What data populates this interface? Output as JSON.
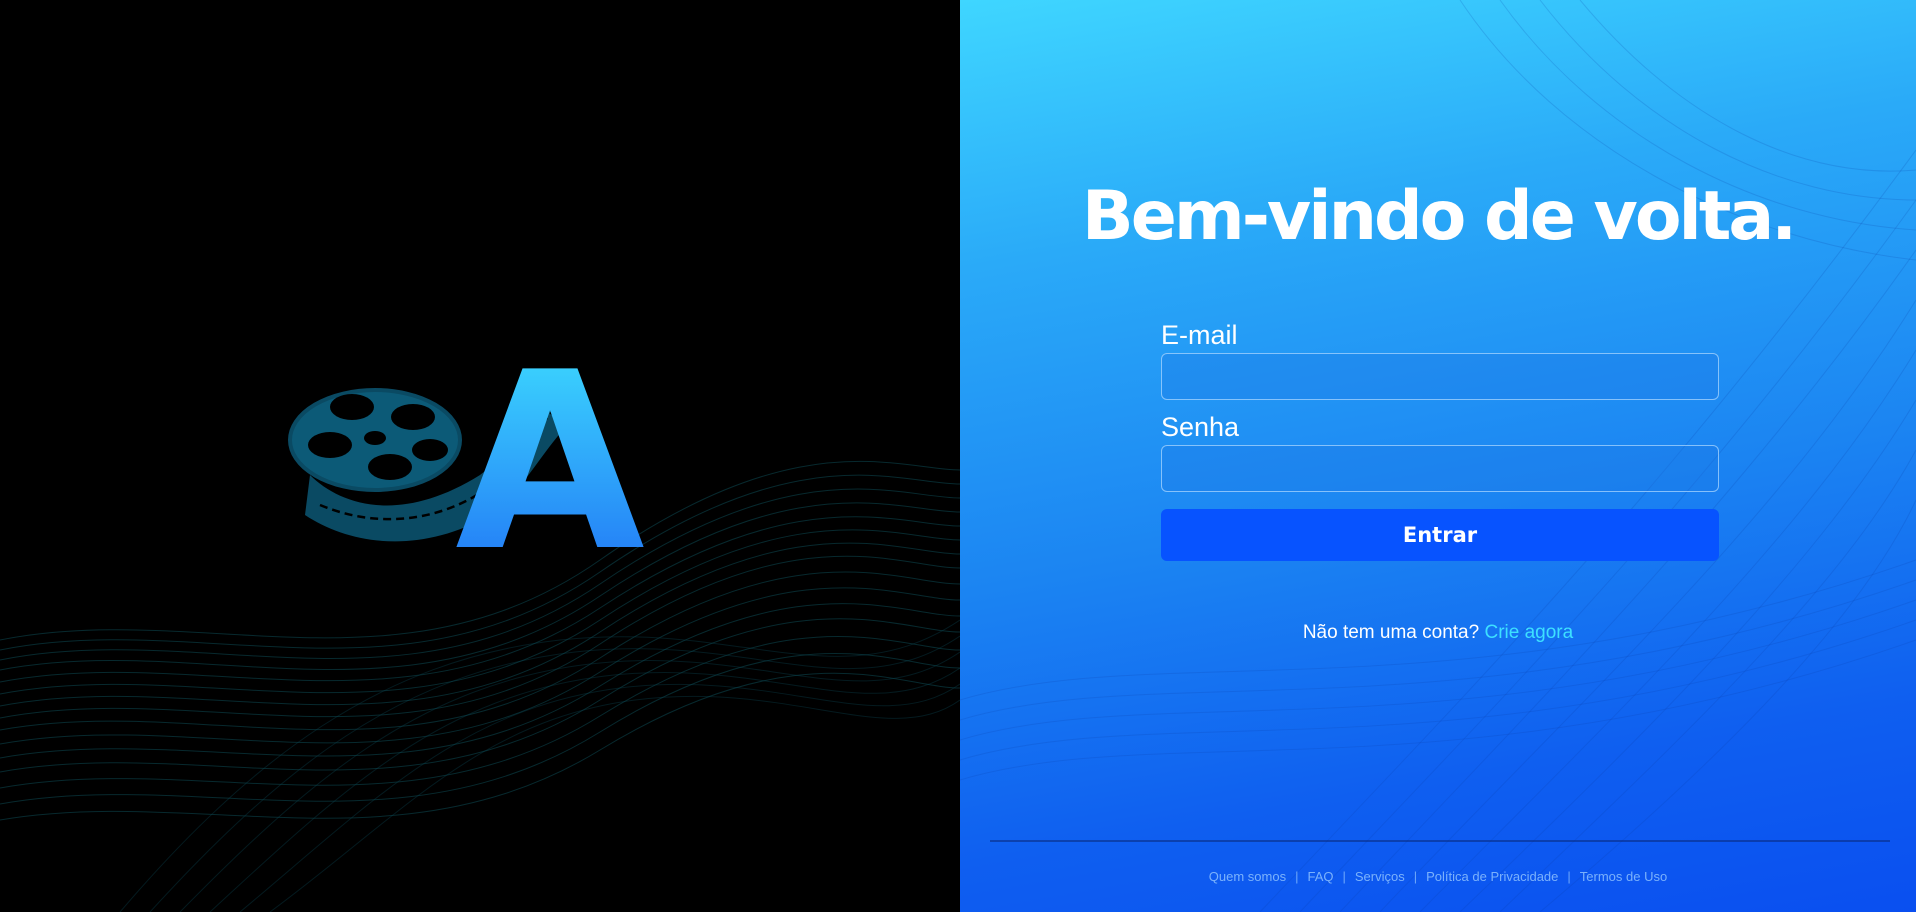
{
  "brand": {
    "logo_letter": "A"
  },
  "login": {
    "heading": "Bem-vindo de volta.",
    "email_label": "E-mail",
    "email_value": "",
    "password_label": "Senha",
    "password_value": "",
    "submit_label": "Entrar",
    "signup_prompt": "Não tem uma conta?",
    "signup_link": "Crie agora"
  },
  "footer": {
    "links": [
      "Quem somos",
      "FAQ",
      "Serviços",
      "Política de Privacidade",
      "Termos de Uso"
    ],
    "separator": "|"
  },
  "colors": {
    "left_background": "#000000",
    "right_gradient_top": "#3fd6ff",
    "right_gradient_bottom": "#0a4ff0",
    "button": "#0753ff",
    "link_accent": "#3de0ff"
  },
  "icons": [
    "film-reel-icon"
  ]
}
